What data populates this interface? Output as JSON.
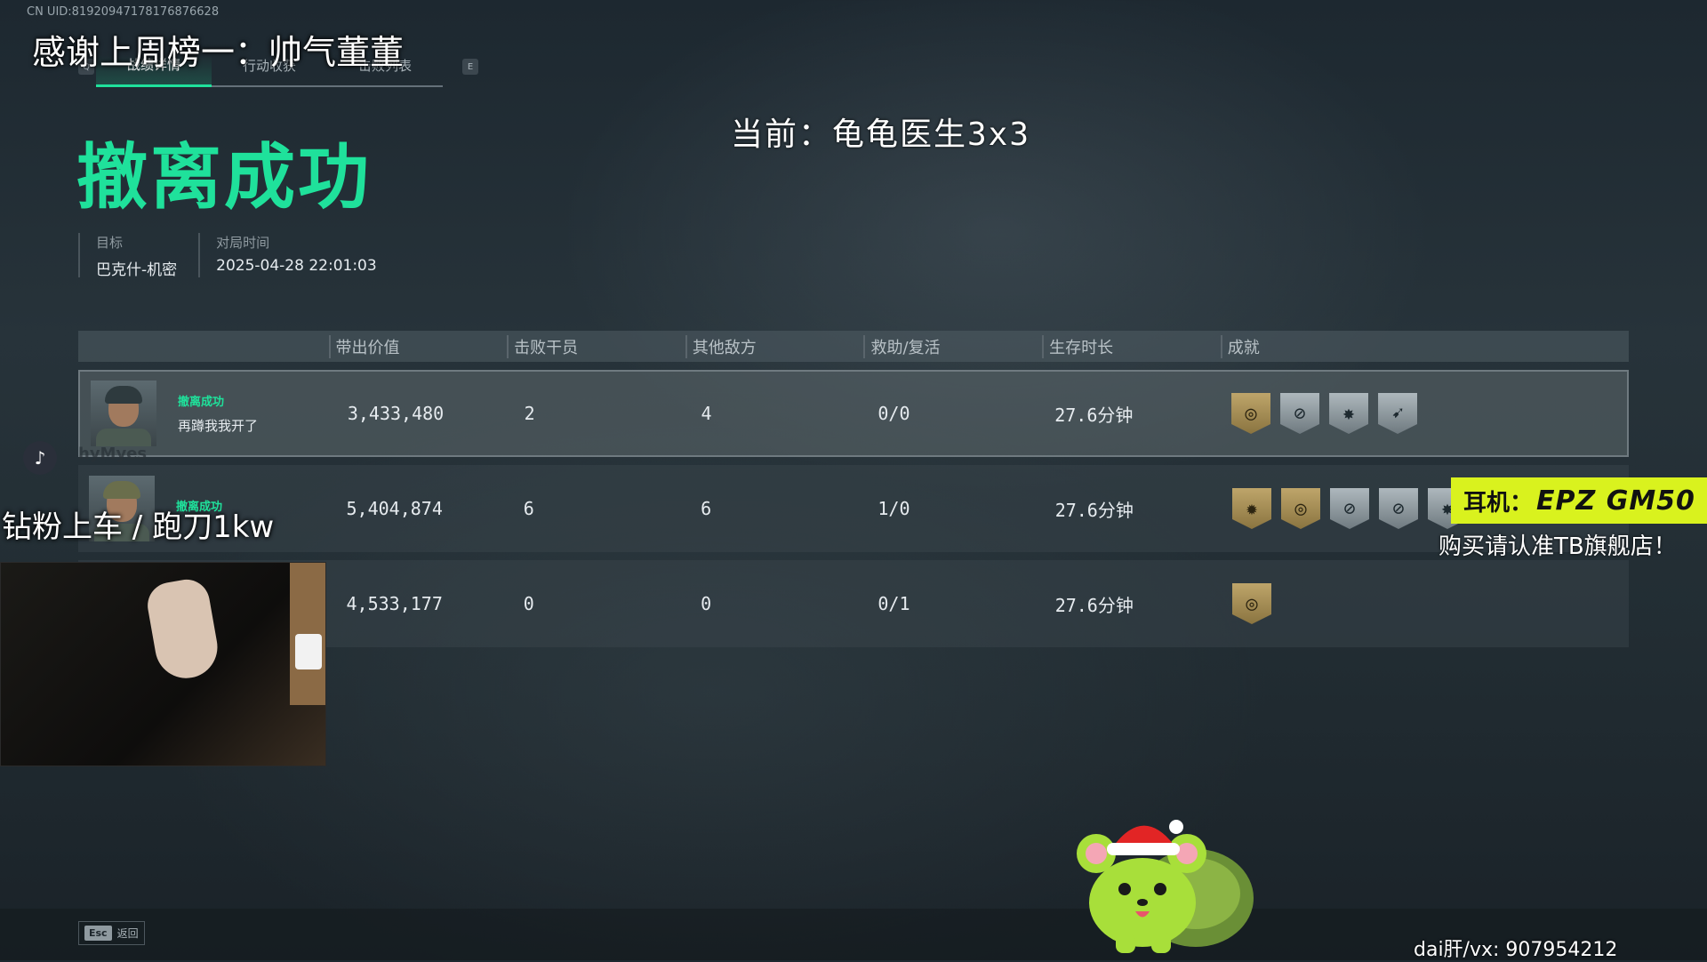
{
  "uid": "CN UID:8192094717817687662‌8",
  "overlay_thanks": "感谢上周榜一：帅气董董",
  "tabs": [
    {
      "label": "战绩详情",
      "active": true
    },
    {
      "label": "行动收获",
      "active": false
    },
    {
      "label": "击败列表",
      "active": false
    }
  ],
  "tab_keys": {
    "left": "Q",
    "right": "E"
  },
  "current_text": "当前：龟龟医生3x3",
  "status_title": "撤离成功",
  "meta": {
    "target_label": "目标",
    "target_value": "巴克什-机密",
    "time_label": "对局时间",
    "time_value": "2025-04-28 22:01:03"
  },
  "table": {
    "headers": [
      "带出价值",
      "击败干员",
      "其他敌方",
      "救助/复活",
      "生存时长",
      "成就"
    ],
    "rows": [
      {
        "status": "撤离成功",
        "name": "再蹲我我开了",
        "value": "3,433,480",
        "kills": "2",
        "other": "4",
        "assist": "0/0",
        "survival": "27.6分钟",
        "badges": [
          {
            "type": "gold",
            "icon": "target-icon"
          },
          {
            "type": "silver",
            "icon": "crosshair-icon"
          },
          {
            "type": "silver",
            "icon": "star-burst-icon"
          },
          {
            "type": "silver",
            "icon": "handshake-icon"
          }
        ]
      },
      {
        "status": "撤离成功",
        "name": "",
        "value": "5,404,874",
        "kills": "6",
        "other": "6",
        "assist": "1/0",
        "survival": "27.6分钟",
        "badges": [
          {
            "type": "gold",
            "icon": "sun-icon"
          },
          {
            "type": "gold",
            "icon": "target-icon"
          },
          {
            "type": "silver",
            "icon": "crosshair-icon"
          },
          {
            "type": "silver",
            "icon": "crosshair-icon"
          },
          {
            "type": "silver",
            "icon": "star-burst-icon"
          }
        ]
      },
      {
        "status": "",
        "name": "",
        "value": "4,533,177",
        "kills": "0",
        "other": "0",
        "assist": "0/1",
        "survival": "27.6分钟",
        "badges": [
          {
            "type": "gold",
            "icon": "target-icon"
          }
        ]
      }
    ]
  },
  "overlay_diamond": "钻粉上车 / 跑刀1kw",
  "faded_name": "hyMyes",
  "ad": {
    "label": "耳机：",
    "brand": "EPZ GM50",
    "note": "购买请认准TB旗舰店！"
  },
  "contact": "dai肝/vx: 907954212",
  "esc": {
    "key": "Esc",
    "label": "返回"
  },
  "colors": {
    "accent": "#1fe19b",
    "ad_bg": "#d9f21e",
    "gold_badge": "#bea56a",
    "silver_badge": "#aeb8bd"
  }
}
